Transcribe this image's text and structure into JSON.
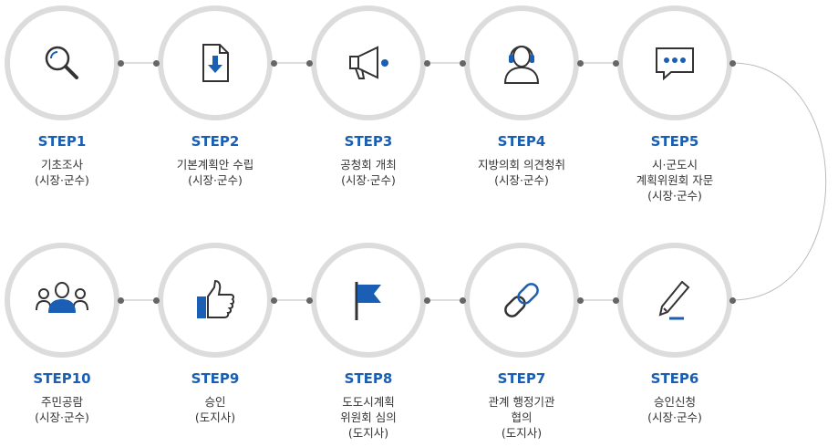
{
  "colors": {
    "accent": "#1a5fb4",
    "ring": "#dcdcdc",
    "connector": "#bbbbbb",
    "text": "#333333",
    "dot": "#666666"
  },
  "steps": [
    {
      "title": "STEP1",
      "lines": [
        "기초조사",
        "(시장·군수)"
      ],
      "icon": "magnifier-icon"
    },
    {
      "title": "STEP2",
      "lines": [
        "기본계획안 수립",
        "(시장·군수)"
      ],
      "icon": "download-document-icon"
    },
    {
      "title": "STEP3",
      "lines": [
        "공청회 개최",
        "(시장·군수)"
      ],
      "icon": "megaphone-icon"
    },
    {
      "title": "STEP4",
      "lines": [
        "지방의회 의견청취",
        "(시장·군수)"
      ],
      "icon": "headset-user-icon"
    },
    {
      "title": "STEP5",
      "lines": [
        "시·군도시",
        "계획위원회 자문",
        "(시장·군수)"
      ],
      "icon": "chat-bubble-icon"
    },
    {
      "title": "STEP6",
      "lines": [
        "승인신청",
        "(시장·군수)"
      ],
      "icon": "pen-icon"
    },
    {
      "title": "STEP7",
      "lines": [
        "관계 행정기관",
        "협의",
        "(도지사)"
      ],
      "icon": "chain-link-icon"
    },
    {
      "title": "STEP8",
      "lines": [
        "도도시계획",
        "위원회 심의",
        "(도지사)"
      ],
      "icon": "flag-icon"
    },
    {
      "title": "STEP9",
      "lines": [
        "승인",
        "(도지사)"
      ],
      "icon": "thumbs-up-icon"
    },
    {
      "title": "STEP10",
      "lines": [
        "주민공람",
        "(시장·군수)"
      ],
      "icon": "people-group-icon"
    }
  ]
}
